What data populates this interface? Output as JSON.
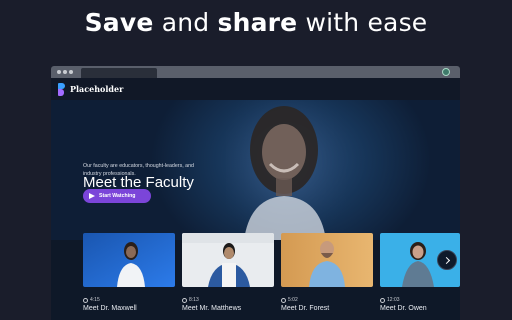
{
  "headline": {
    "part1": "Save",
    "part2": "and",
    "part3": "share",
    "part4": "with ease"
  },
  "app": {
    "brand": "Placeholder"
  },
  "hero": {
    "title": "Meet the Faculty",
    "description": "Our faculty are educators, thought-leaders, and industry professionals.",
    "cta_label": "Start Watching"
  },
  "cards": [
    {
      "duration": "4:15",
      "title": "Meet Dr. Maxwell"
    },
    {
      "duration": "8:13",
      "title": "Meet Mr. Matthews"
    },
    {
      "duration": "5:02",
      "title": "Meet Dr. Forest"
    },
    {
      "duration": "12:03",
      "title": "Meet Dr. Owen"
    }
  ],
  "icons": {
    "next": "chevron-right-icon",
    "clock": "clock-icon",
    "play": "play-icon"
  },
  "colors": {
    "accent": "#7b45d9",
    "background": "#1a1d2b",
    "hero": "#163457"
  }
}
